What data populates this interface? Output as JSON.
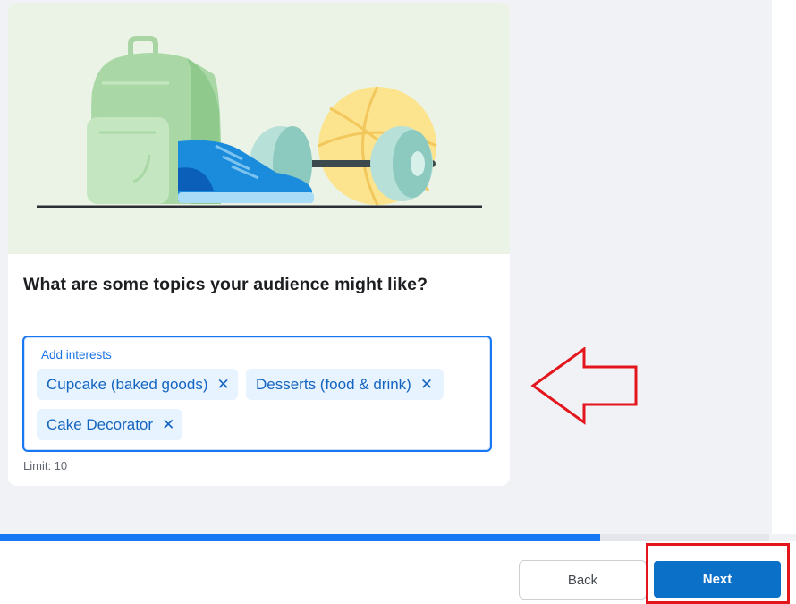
{
  "card": {
    "question": "What are some topics your audience might like?",
    "interests_field": {
      "label": "Add interests",
      "chips": [
        {
          "label": "Cupcake (baked goods)",
          "remove_icon": "close-icon"
        },
        {
          "label": "Desserts (food & drink)",
          "remove_icon": "close-icon"
        },
        {
          "label": "Cake Decorator",
          "remove_icon": "close-icon"
        }
      ]
    },
    "limit_text": "Limit: 10",
    "remove_glyph": "✕"
  },
  "progress": {
    "fraction": 0.78
  },
  "footer": {
    "back_label": "Back",
    "next_label": "Next"
  },
  "annotations": {
    "arrow_color": "#e4161d",
    "highlight_color": "#e4161d"
  },
  "colors": {
    "accent": "#1877f2",
    "primary_button": "#0a70c8",
    "chip_bg": "#e7f3ff"
  }
}
